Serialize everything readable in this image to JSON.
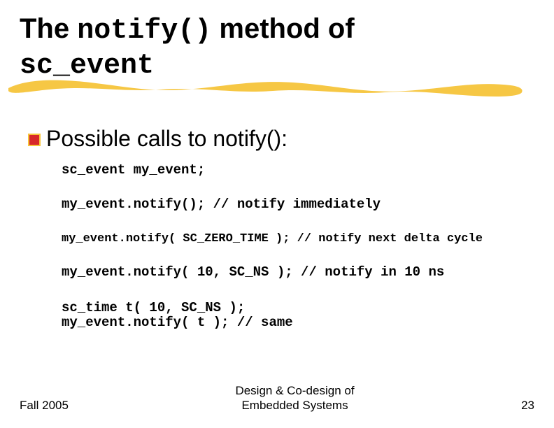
{
  "title": {
    "part1": "The ",
    "code1": "notify()",
    "part2": " method of ",
    "code2": "sc_event"
  },
  "bullet": {
    "text": "Possible calls to notify():"
  },
  "code": {
    "l1": "sc_event my_event;",
    "l2": "my_event.notify(); // notify immediately",
    "l3": "my_event.notify( SC_ZERO_TIME ); // notify next delta cycle",
    "l4": "my_event.notify( 10, SC_NS ); // notify in 10 ns",
    "l5": "sc_time t( 10, SC_NS );",
    "l6": "my_event.notify( t ); // same"
  },
  "footer": {
    "left": "Fall 2005",
    "center_l1": "Design & Co-design of",
    "center_l2": "Embedded Systems",
    "right": "23"
  },
  "colors": {
    "stroke": "#f6c43a",
    "bullet_fill": "#d72828",
    "bullet_stroke": "#f6c43a"
  }
}
